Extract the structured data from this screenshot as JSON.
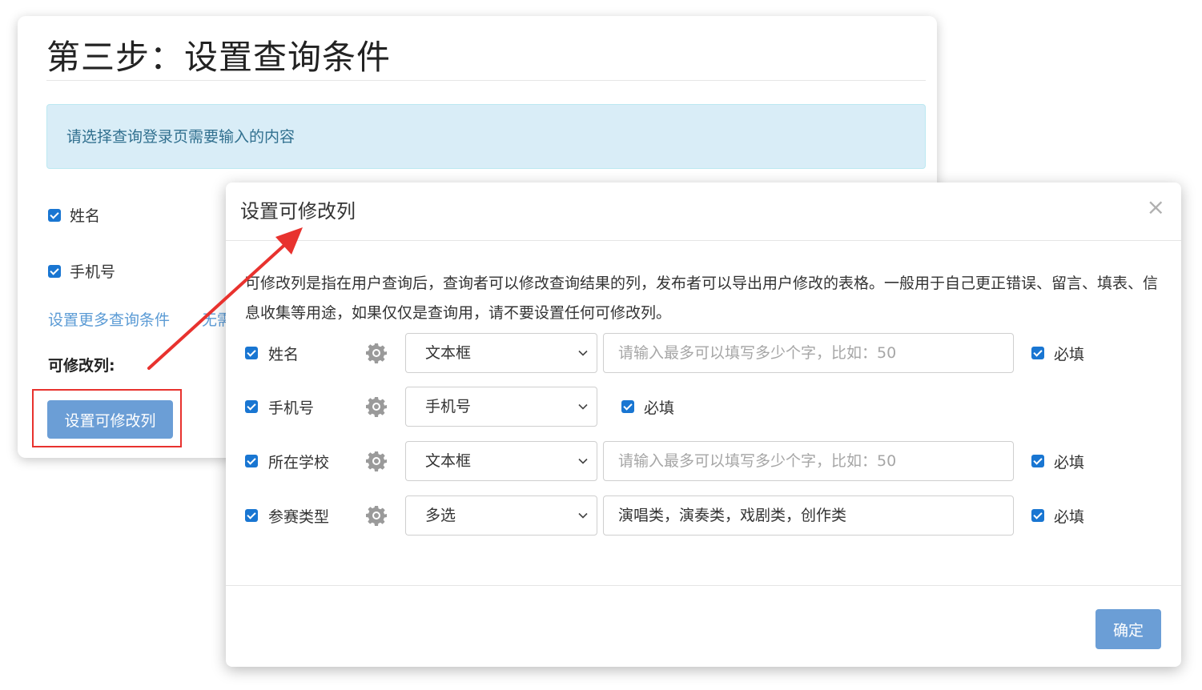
{
  "background": {
    "title": "第三步：设置查询条件",
    "alert": "请选择查询登录页需要输入的内容",
    "checks": [
      {
        "label": "姓名"
      },
      {
        "label": "手机号"
      }
    ],
    "more_conditions_link": "设置更多查询条件",
    "truncated_link": "无需",
    "editable_columns_label": "可修改列:",
    "set_editable_button": "设置可修改列"
  },
  "modal": {
    "title": "设置可修改列",
    "close_glyph": "×",
    "description": "可修改列是指在用户查询后，查询者可以修改查询结果的列，发布者可以导出用户修改的表格。一般用于自己更正错误、留言、填表、信息收集等用途，如果仅仅是查询用，请不要设置任何可修改列。",
    "rows": [
      {
        "label": "姓名",
        "type": "文本框",
        "input": "请输入最多可以填写多少个字，比如：50",
        "input_kind": "placeholder",
        "required": "必填"
      },
      {
        "label": "手机号",
        "type": "手机号",
        "input": "",
        "input_kind": "none",
        "required": "必填"
      },
      {
        "label": "所在学校",
        "type": "文本框",
        "input": "请输入最多可以填写多少个字，比如：50",
        "input_kind": "placeholder",
        "required": "必填"
      },
      {
        "label": "参赛类型",
        "type": "多选",
        "input": "演唱类，演奏类，戏剧类，创作类",
        "input_kind": "value",
        "required": "必填"
      }
    ],
    "confirm_button": "确定"
  },
  "colors": {
    "accent": "#1976d2",
    "button": "#6b9ed6",
    "annotation_red": "#e8322e",
    "alert_bg": "#d9edf7"
  },
  "icons": {
    "settings": "gear-icon",
    "close": "close-icon",
    "dropdown": "chevron-down-icon",
    "checkbox": "checkbox-checked-icon"
  }
}
